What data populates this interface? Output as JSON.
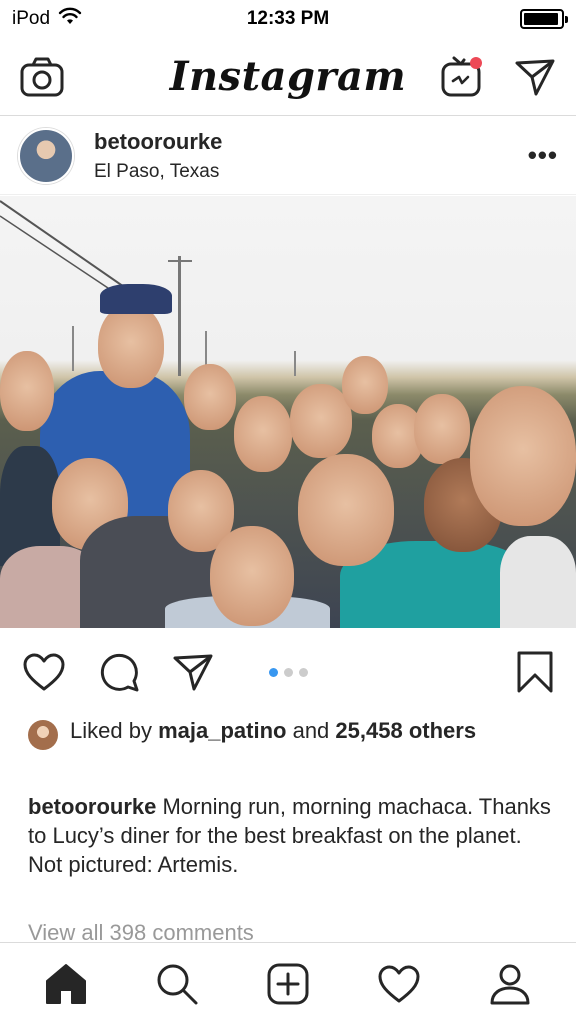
{
  "status_bar": {
    "device": "iPod",
    "time": "12:33 PM",
    "battery_level": 0.95
  },
  "nav": {
    "logo": "Instagram",
    "icons": [
      "camera-icon",
      "igtv-icon",
      "direct-message-icon"
    ],
    "igtv_badge_color": "#ed4956"
  },
  "post": {
    "username": "betoorourke",
    "location": "El Paso, Texas",
    "more_label": "•••",
    "carousel": {
      "total": 3,
      "current": 1
    },
    "likes": {
      "prefix": "Liked by",
      "user": "maja_patino",
      "connector": "and",
      "count": "25,458",
      "suffix": "others"
    },
    "caption": {
      "username": "betoorourke",
      "text": "Morning run, morning machaca. Thanks to Lucy’s diner for the best breakfast on the planet. Not pictured: Artemis."
    },
    "view_comments": "View all 398 comments"
  },
  "tab_bar": {
    "icons": [
      "home-icon",
      "search-icon",
      "new-post-icon",
      "activity-icon",
      "profile-icon"
    ]
  },
  "colors": {
    "text": "#262626",
    "muted": "#999999",
    "accent": "#3897f0",
    "divider": "#dbdbdb"
  }
}
